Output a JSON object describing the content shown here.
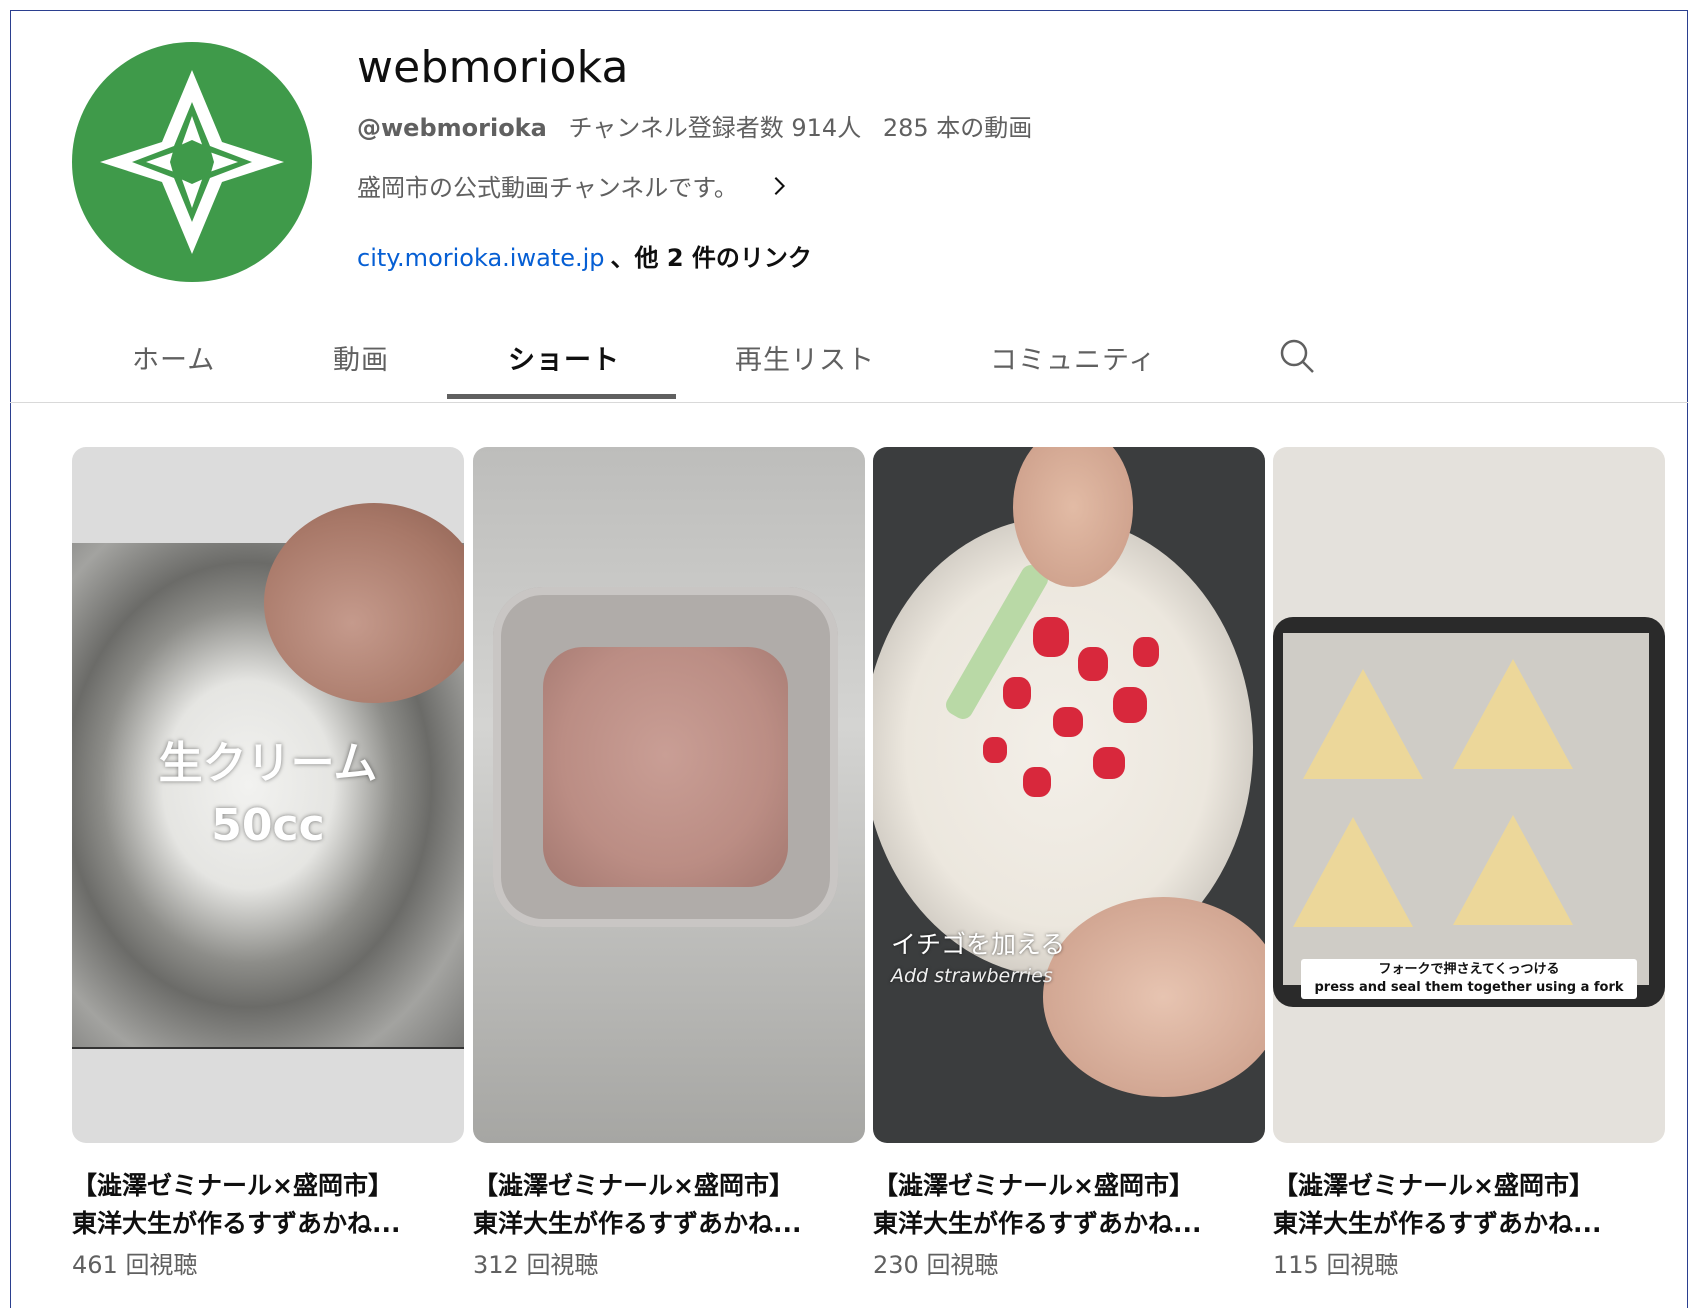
{
  "channel": {
    "name": "webmorioka",
    "handle": "@webmorioka",
    "subscribers": "チャンネル登録者数 914人",
    "video_count": "285 本の動画",
    "description": "盛岡市の公式動画チャンネルです。",
    "link": "city.morioka.iwate.jp",
    "more_links": "、他 2 件のリンク",
    "avatar_color": "#3f9a4a"
  },
  "tabs": [
    {
      "label": "ホーム"
    },
    {
      "label": "動画"
    },
    {
      "label": "ショート",
      "active": true
    },
    {
      "label": "再生リスト"
    },
    {
      "label": "コミュニティ"
    }
  ],
  "shorts": [
    {
      "title_line1": "【澁澤ゼミナール×盛岡市】",
      "title_line2": "東洋大生が作るすずあかね...",
      "views": "461 回視聴",
      "overlay_line1": "生クリーム",
      "overlay_line2": "50cc"
    },
    {
      "title_line1": "【澁澤ゼミナール×盛岡市】",
      "title_line2": "東洋大生が作るすずあかね...",
      "views": "312 回視聴"
    },
    {
      "title_line1": "【澁澤ゼミナール×盛岡市】",
      "title_line2": "東洋大生が作るすずあかね...",
      "views": "230 回視聴",
      "overlay_line1": "イチゴを加える",
      "overlay_line2": "Add strawberries"
    },
    {
      "title_line1": "【澁澤ゼミナール×盛岡市】",
      "title_line2": "東洋大生が作るすずあかね...",
      "views": "115 回視聴",
      "overlay_line1": "フォークで押さえてくっつける",
      "overlay_line2": "press and seal them together using a fork"
    }
  ]
}
